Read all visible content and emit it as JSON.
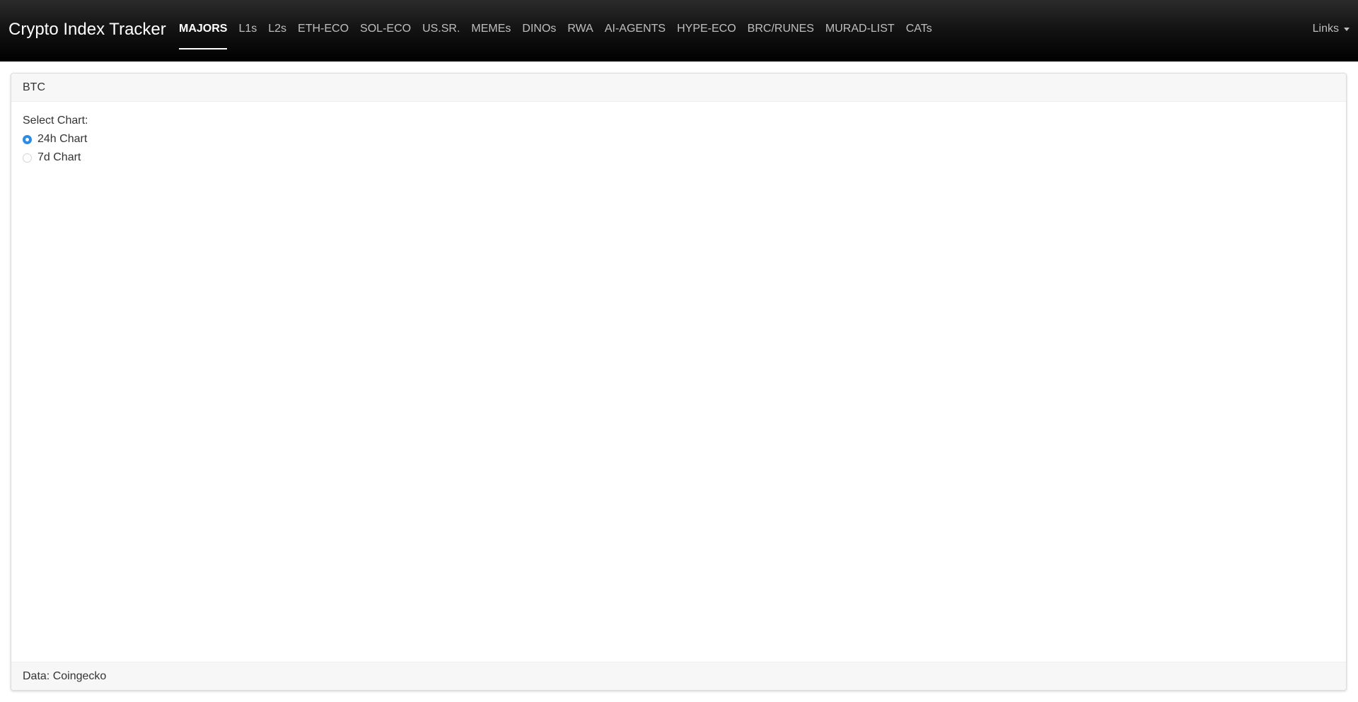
{
  "app": {
    "brand": "Crypto Index Tracker"
  },
  "nav": {
    "items": [
      {
        "label": "MAJORS",
        "active": true
      },
      {
        "label": "L1s",
        "active": false
      },
      {
        "label": "L2s",
        "active": false
      },
      {
        "label": "ETH-ECO",
        "active": false
      },
      {
        "label": "SOL-ECO",
        "active": false
      },
      {
        "label": "US.SR.",
        "active": false
      },
      {
        "label": "MEMEs",
        "active": false
      },
      {
        "label": "DINOs",
        "active": false
      },
      {
        "label": "RWA",
        "active": false
      },
      {
        "label": "AI-AGENTS",
        "active": false
      },
      {
        "label": "HYPE-ECO",
        "active": false
      },
      {
        "label": "BRC/RUNES",
        "active": false
      },
      {
        "label": "MURAD-LIST",
        "active": false
      },
      {
        "label": "CATs",
        "active": false
      }
    ],
    "links_label": "Links"
  },
  "card": {
    "header": "BTC",
    "select_label": "Select Chart:",
    "options": [
      {
        "label": "24h Chart",
        "checked": true
      },
      {
        "label": "7d Chart",
        "checked": false
      }
    ],
    "footer": "Data: Coingecko"
  },
  "colors": {
    "accent": "#2b8ce6",
    "navbar": "#000000"
  }
}
